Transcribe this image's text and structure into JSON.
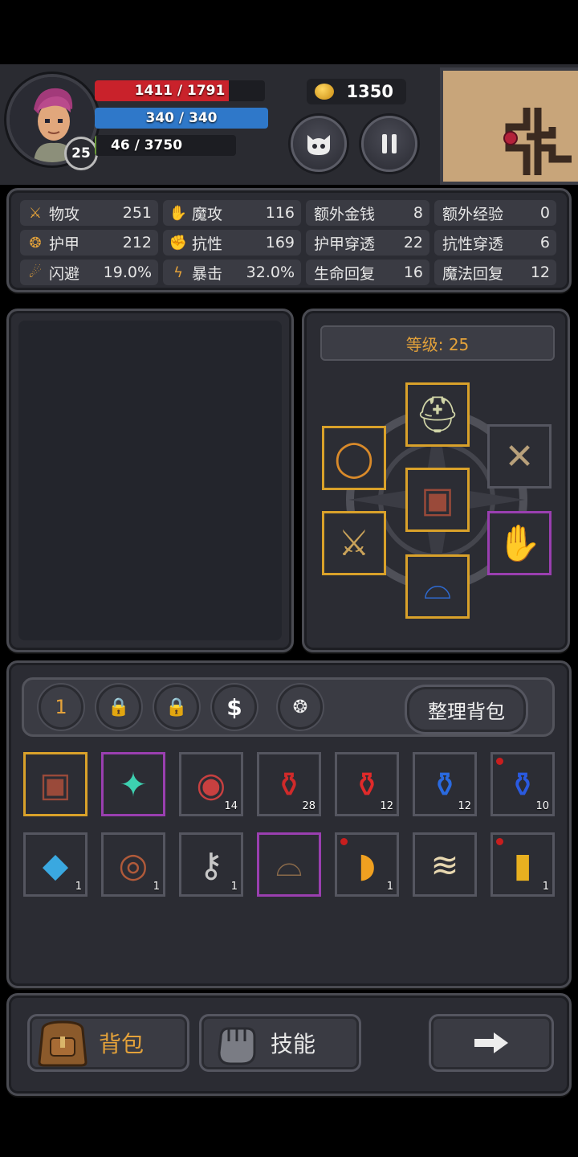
{
  "player": {
    "level": "25",
    "hp": "1411 / 1791",
    "hp_fraction": 0.788,
    "mp": "340 / 340",
    "mp_fraction": 1.0,
    "xp": "46 / 3750",
    "xp_fraction": 0.012
  },
  "gold": "1350",
  "stats": [
    {
      "icon": "sword-icon",
      "label": "物攻",
      "value": "251"
    },
    {
      "icon": "magic-hand-icon",
      "label": "魔攻",
      "value": "116"
    },
    {
      "icon": "",
      "label": "额外金钱",
      "value": "8"
    },
    {
      "icon": "",
      "label": "额外经验",
      "value": "0"
    },
    {
      "icon": "paw-icon",
      "label": "护甲",
      "value": "212"
    },
    {
      "icon": "muscle-icon",
      "label": "抗性",
      "value": "169"
    },
    {
      "icon": "",
      "label": "护甲穿透",
      "value": "22"
    },
    {
      "icon": "",
      "label": "抗性穿透",
      "value": "6"
    },
    {
      "icon": "runner-icon",
      "label": "闪避",
      "value": "19.0%"
    },
    {
      "icon": "lightning-icon",
      "label": "暴击",
      "value": "32.0%"
    },
    {
      "icon": "",
      "label": "生命回复",
      "value": "16"
    },
    {
      "icon": "",
      "label": "魔法回复",
      "value": "12"
    }
  ],
  "equipment": {
    "level_label": "等级: 25",
    "slots": [
      {
        "name": "helmet",
        "icon": "helmet-icon",
        "rarity": "gold"
      },
      {
        "name": "ring",
        "icon": "ring-icon",
        "rarity": "gold"
      },
      {
        "name": "amulet",
        "icon": "chain-icon",
        "rarity": "empty"
      },
      {
        "name": "armor",
        "icon": "armor-icon",
        "rarity": "gold"
      },
      {
        "name": "weapon",
        "icon": "sword-icon",
        "rarity": "gold"
      },
      {
        "name": "gloves",
        "icon": "gauntlet-icon",
        "rarity": "purple"
      },
      {
        "name": "boots",
        "icon": "boots-icon",
        "rarity": "gold"
      }
    ]
  },
  "bag": {
    "tabs": [
      {
        "label": "1",
        "icon": ""
      },
      {
        "label": "",
        "icon": "lock-icon"
      },
      {
        "label": "",
        "icon": "lock-icon"
      },
      {
        "label": "",
        "icon": "dollar-icon"
      },
      {
        "label": "",
        "icon": "paw-icon"
      }
    ],
    "sort_label": "整理背包",
    "items": [
      {
        "icon": "armor-icon",
        "rarity": "gold",
        "count": "",
        "dot": false
      },
      {
        "icon": "mech-gauntlet-icon",
        "rarity": "purple",
        "count": "",
        "dot": false
      },
      {
        "icon": "meat-icon",
        "rarity": "normal",
        "count": "14",
        "dot": false
      },
      {
        "icon": "red-potion-small-icon",
        "rarity": "normal",
        "count": "28",
        "dot": false
      },
      {
        "icon": "red-potion-icon",
        "rarity": "normal",
        "count": "12",
        "dot": false
      },
      {
        "icon": "blue-potion-small-icon",
        "rarity": "normal",
        "count": "12",
        "dot": false
      },
      {
        "icon": "blue-potion-icon",
        "rarity": "normal",
        "count": "10",
        "dot": true
      },
      {
        "icon": "crystal-icon",
        "rarity": "normal",
        "count": "1",
        "dot": false
      },
      {
        "icon": "eye-book-icon",
        "rarity": "normal",
        "count": "1",
        "dot": false
      },
      {
        "icon": "key-icon",
        "rarity": "normal",
        "count": "1",
        "dot": false
      },
      {
        "icon": "boot-icon",
        "rarity": "purple",
        "count": "",
        "dot": false
      },
      {
        "icon": "horn-icon",
        "rarity": "normal",
        "count": "1",
        "dot": true
      },
      {
        "icon": "scroll-icon",
        "rarity": "normal",
        "count": "",
        "dot": false
      },
      {
        "icon": "paint-tube-icon",
        "rarity": "normal",
        "count": "1",
        "dot": true
      }
    ]
  },
  "nav": {
    "bag_label": "背包",
    "skills_label": "技能"
  },
  "colors": {
    "hp": "#c9222b",
    "mp": "#2f78c9",
    "gold_border": "#d9a12a",
    "purple_border": "#9a3fb0",
    "accent": "#e4a23a"
  }
}
